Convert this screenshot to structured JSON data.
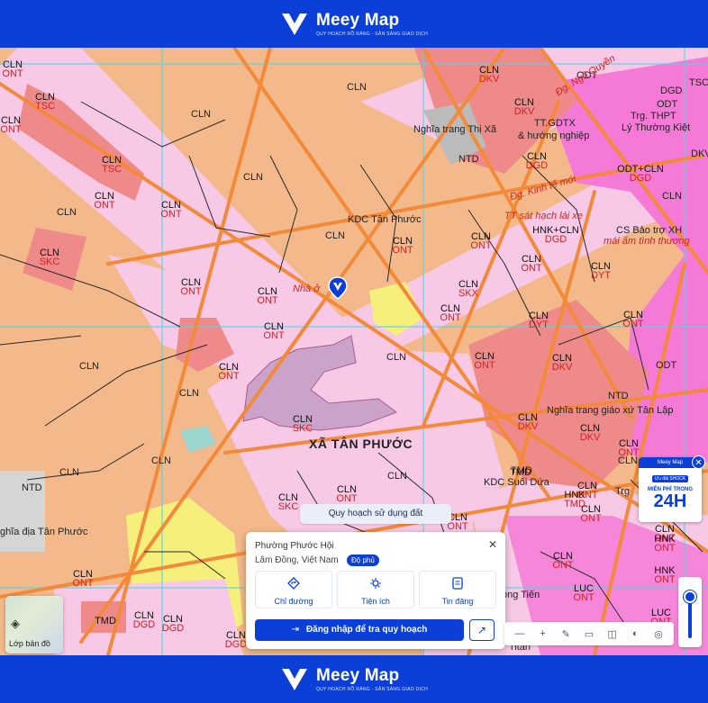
{
  "brand": {
    "name": "Meey Map",
    "tagline": "QUY HOẠCH RÕ RÀNG - SẴN SÀNG GIAO DỊCH"
  },
  "map": {
    "labels": [
      {
        "id": "l1",
        "code": "CLN",
        "sub": "ONT"
      },
      {
        "id": "l2",
        "code": "CLN",
        "sub": "TSC"
      },
      {
        "id": "l3",
        "code": "CLN",
        "sub": "ONT"
      },
      {
        "id": "l4",
        "code": "CLN",
        "sub": "TSC"
      },
      {
        "id": "l5",
        "code": "CLN",
        "sub": "ONT"
      },
      {
        "id": "l6",
        "code": "CLN",
        "sub": "SKC"
      },
      {
        "id": "l7",
        "code": "CLN",
        "sub": "ONT"
      },
      {
        "id": "l8",
        "code": "CLN",
        "sub": "ONT"
      },
      {
        "id": "l9",
        "code": "CLN",
        "sub": "ONT"
      },
      {
        "id": "l10",
        "code": "CLN",
        "sub": "ONT"
      },
      {
        "id": "l11",
        "code": "CLN",
        "sub": "ONT"
      },
      {
        "id": "l12",
        "code": "CLN",
        "sub": "ONT"
      },
      {
        "id": "l13",
        "code": "CLN",
        "sub": "DKV"
      },
      {
        "id": "l14",
        "code": "CLN",
        "sub": "DKV"
      },
      {
        "id": "l15",
        "code": "CLN",
        "sub": "ONT"
      },
      {
        "id": "l16",
        "code": "CLN",
        "sub": "ONT"
      },
      {
        "id": "l17",
        "code": "CLN",
        "sub": "ONT"
      },
      {
        "id": "l18",
        "code": "CLN",
        "sub": "SKX"
      },
      {
        "id": "l19",
        "code": "CLN",
        "sub": "ONT"
      },
      {
        "id": "l20",
        "code": "CLN",
        "sub": "DYT"
      },
      {
        "id": "l21",
        "code": "CLN",
        "sub": "ONT"
      },
      {
        "id": "l22",
        "code": "CLN",
        "sub": "DKV"
      },
      {
        "id": "l23",
        "code": "CLN",
        "sub": "DKV"
      },
      {
        "id": "l24",
        "code": "CLN",
        "sub": "ONT"
      },
      {
        "id": "l25",
        "code": "CLN",
        "sub": "DKV"
      },
      {
        "id": "l26",
        "code": "CLN",
        "sub": "SKC"
      },
      {
        "id": "l27",
        "code": "CLN",
        "sub": "ONT"
      },
      {
        "id": "l28",
        "code": "CLN",
        "sub": "SKC"
      },
      {
        "id": "l29",
        "code": "CLN",
        "sub": "ONT"
      },
      {
        "id": "l30",
        "code": "CLN",
        "sub": "ONT"
      },
      {
        "id": "l31",
        "code": "CLN",
        "sub": "ONT"
      },
      {
        "id": "l32",
        "code": "HNK",
        "sub": "ONT"
      },
      {
        "id": "l33",
        "code": "HNK",
        "sub": "ONT"
      },
      {
        "id": "l34",
        "code": "CLN",
        "sub": "ONT"
      },
      {
        "id": "l35",
        "code": "CLN",
        "sub": "ONT"
      },
      {
        "id": "l36",
        "code": "LUC",
        "sub": "ONT"
      },
      {
        "id": "l37",
        "code": "CLN",
        "sub": "ONT"
      },
      {
        "id": "l38",
        "code": "CLN",
        "sub": "DGD"
      },
      {
        "id": "l39",
        "code": "CLN",
        "sub": "DGD"
      },
      {
        "id": "l40",
        "code": "TMD",
        "sub": ""
      },
      {
        "id": "l41",
        "code": "CLN",
        "sub": "DGD"
      },
      {
        "id": "l42",
        "code": "TMD",
        "sub": ""
      },
      {
        "id": "l43",
        "code": "HNK",
        "sub": "TMD"
      },
      {
        "id": "l44",
        "code": "CLN",
        "sub": "DGD"
      },
      {
        "id": "l45",
        "code": "ODT+CLN",
        "sub": "DGD"
      },
      {
        "id": "l46",
        "code": "HNK+CLN",
        "sub": "DGD"
      },
      {
        "id": "l47",
        "code": "CLN",
        "sub": "DYT"
      },
      {
        "id": "l48",
        "code": "LUC",
        "sub": "ONT"
      }
    ],
    "plain": [
      {
        "id": "p1",
        "text": "CLN"
      },
      {
        "id": "p2",
        "text": "CLN"
      },
      {
        "id": "p3",
        "text": "CLN"
      },
      {
        "id": "p4",
        "text": "CLN"
      },
      {
        "id": "p5",
        "text": "CLN"
      },
      {
        "id": "p6",
        "text": "CLN"
      },
      {
        "id": "p7",
        "text": "CLN"
      },
      {
        "id": "p8",
        "text": "CLN"
      },
      {
        "id": "p9",
        "text": "CLN"
      },
      {
        "id": "p10",
        "text": "CLN"
      },
      {
        "id": "p11",
        "text": "CLN"
      },
      {
        "id": "p12",
        "text": "CLN"
      },
      {
        "id": "p13",
        "text": "NTD"
      },
      {
        "id": "p14",
        "text": "NTD"
      },
      {
        "id": "p15",
        "text": "NTD"
      },
      {
        "id": "p16",
        "text": "ODT"
      },
      {
        "id": "p17",
        "text": "ODT"
      },
      {
        "id": "p18",
        "text": "TMD"
      },
      {
        "id": "p19",
        "text": "KDC Tân Phước"
      },
      {
        "id": "p20",
        "text": "Nghĩa trang Thị Xã"
      },
      {
        "id": "p21",
        "text": "TT.GDTX"
      },
      {
        "id": "p22",
        "text": "& hướng nghiệp"
      },
      {
        "id": "p23",
        "text": "Trg. THPT"
      },
      {
        "id": "p24",
        "text": "Lý Thường Kiệt"
      },
      {
        "id": "p25",
        "text": "CS Bảo trợ XH"
      },
      {
        "id": "p26",
        "text": "Nghĩa trang giáo xứ Tân Lập"
      },
      {
        "id": "p27",
        "text": "KDC Suối Dứa"
      },
      {
        "id": "p28",
        "text": "ghĩa địa Tân Phước"
      },
      {
        "id": "p29",
        "text": "ông Tiến"
      },
      {
        "id": "p30",
        "text": "Titan"
      },
      {
        "id": "p31",
        "text": "ODT"
      },
      {
        "id": "p32",
        "text": "TSC"
      },
      {
        "id": "p33",
        "text": "DKV"
      },
      {
        "id": "p34",
        "text": "DGD"
      },
      {
        "id": "p35",
        "text": "CLN"
      },
      {
        "id": "p36",
        "text": "Trg"
      }
    ],
    "red_plain": [
      {
        "id": "r1",
        "text": "Đg. Ngô Quyền"
      },
      {
        "id": "r2",
        "text": "Đg. Kinh tế mới"
      },
      {
        "id": "r3",
        "text": "TT sát hạch lái xe"
      },
      {
        "id": "r4",
        "text": "mái ấm tình thương"
      },
      {
        "id": "r5",
        "text": "Nhà ở"
      }
    ],
    "district": "XÃ TÂN PHƯỚC"
  },
  "ad": {
    "head": "Meey Map",
    "chip": "Ưu đãi SHOCK",
    "line": "MIỄN PHÍ TRONG",
    "big": "24H"
  },
  "overlay": {
    "map_type_chip": "Quy hoạch sử dụng đất"
  },
  "panel": {
    "title": "Phường Phước Hội",
    "subtitle": "Lâm Đồng, Việt Nam",
    "badge": "Độ phủ",
    "actions": [
      {
        "label": "Chỉ đường",
        "icon": "directions-icon"
      },
      {
        "label": "Tiện ích",
        "icon": "amenities-icon"
      },
      {
        "label": "Tin đăng",
        "icon": "listings-icon"
      }
    ],
    "login": "Đăng nhập để tra quy hoạch",
    "share_icon": "share-icon"
  },
  "layers": {
    "label": "Lớp bản đồ"
  },
  "toolbar": {
    "items": [
      "ruler-icon",
      "plus-icon",
      "draw-icon",
      "card-icon",
      "split-icon",
      "compare-icon",
      "locate-icon"
    ]
  },
  "zoom": {
    "level": 0.85
  },
  "colors": {
    "brand_blue": "#0b3fd8",
    "cln_orange": "#f3b98a",
    "ont_pink": "#f7c9e6",
    "urban_magenta": "#f57ad7",
    "road_orange": "#f28a3a",
    "service_red": "#ee8a8a",
    "lake_mauve": "#c9a3c9",
    "grid_cyan": "#53d6e2"
  }
}
